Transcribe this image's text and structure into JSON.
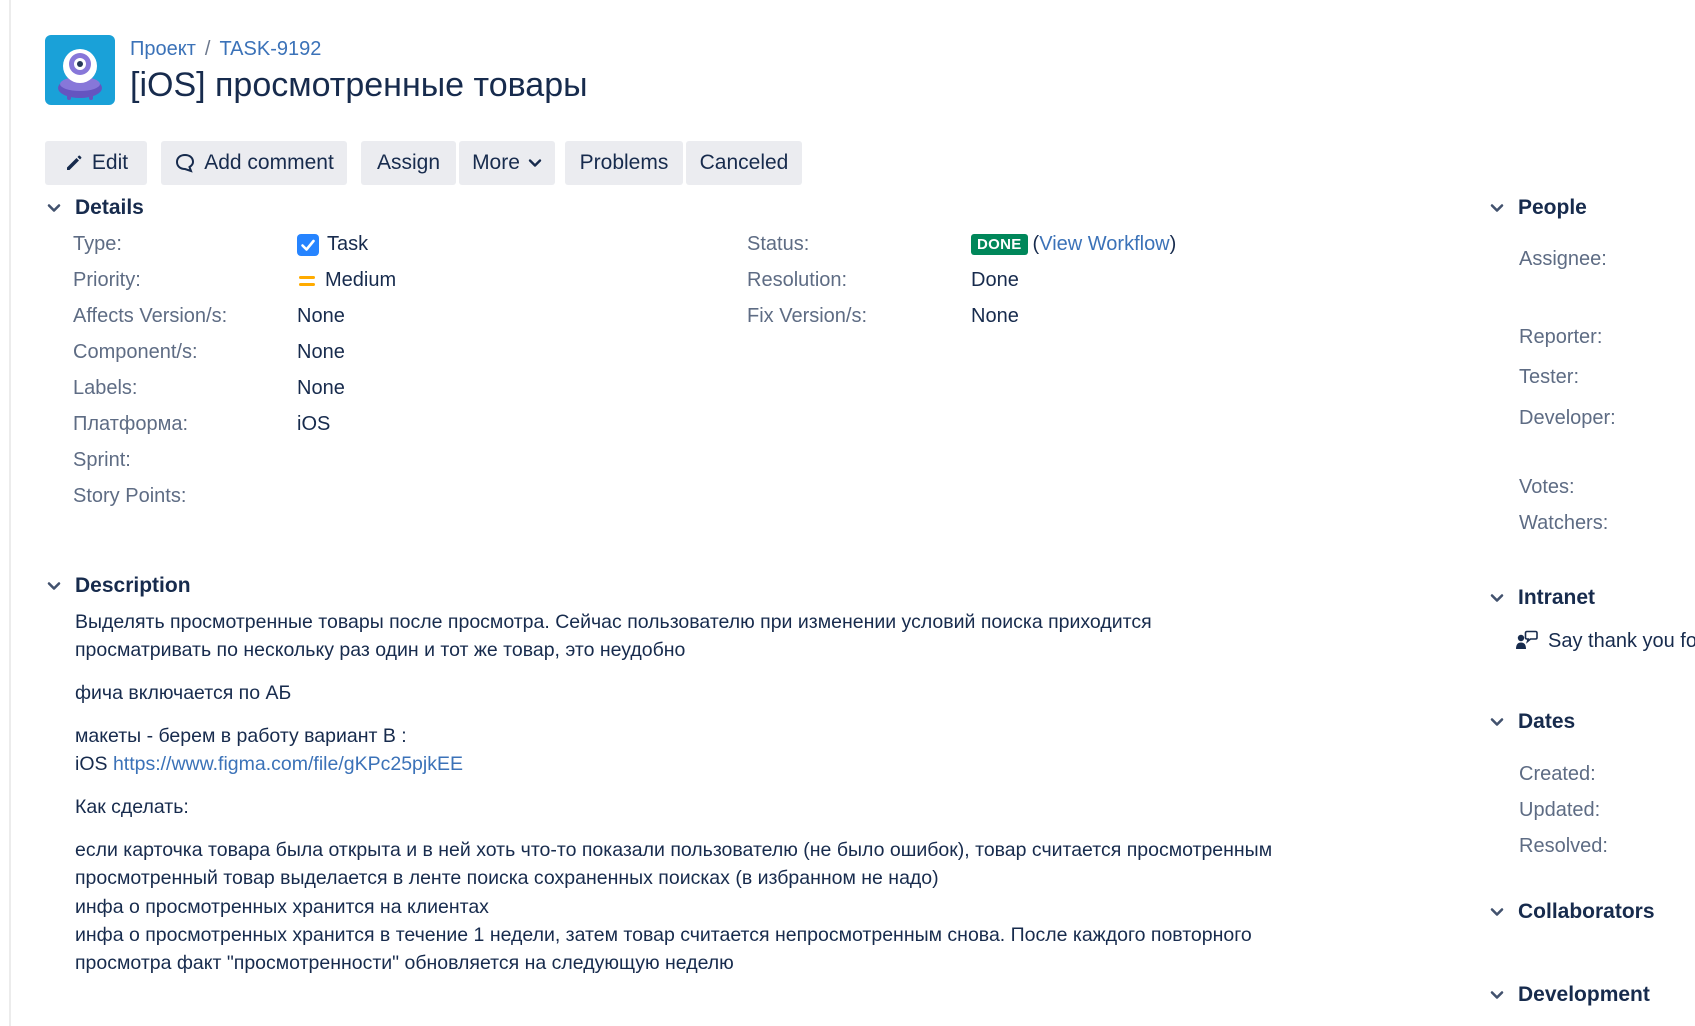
{
  "breadcrumb": {
    "project": "Проект",
    "separator": "/",
    "issue_key": "TASK-9192"
  },
  "title": "[iOS] просмотренные товары",
  "toolbar": {
    "edit": "Edit",
    "add_comment": "Add comment",
    "assign": "Assign",
    "more": "More",
    "problems": "Problems",
    "canceled": "Canceled"
  },
  "details": {
    "heading": "Details",
    "type_label": "Type:",
    "type_value": "Task",
    "priority_label": "Priority:",
    "priority_value": "Medium",
    "affects_label": "Affects Version/s:",
    "affects_value": "None",
    "component_label": "Component/s:",
    "component_value": "None",
    "labels_label": "Labels:",
    "labels_value": "None",
    "platform_label": "Платформа:",
    "platform_value": "iOS",
    "sprint_label": "Sprint:",
    "story_points_label": "Story Points:",
    "status_label": "Status:",
    "status_value": "DONE",
    "workflow_open": "(",
    "workflow_link": "View Workflow",
    "workflow_close": ")",
    "resolution_label": "Resolution:",
    "resolution_value": "Done",
    "fix_label": "Fix Version/s:",
    "fix_value": "None"
  },
  "description": {
    "heading": "Description",
    "line1": "Выделять просмотренные товары после просмотра. Сейчас пользователю при изменении условий поиска приходится",
    "line2": "просматривать по нескольку раз один и тот же товар, это неудобно",
    "line3": "фича включается по АБ",
    "line4": "макеты - берем в работу вариант В :",
    "line5_prefix": "iOS",
    "line5_link": "https://www.figma.com/file/gKPc25pjkEE",
    "line6": "Как сделать:",
    "line7": "если карточка товара была открыта и в ней хоть что-то показали пользователю (не было ошибок), товар считается просмотренным",
    "line8": "просмотренный товар выделается в ленте поиска сохраненных поисках (в избранном не надо)",
    "line9": "инфа о просмотренных хранится на клиентах",
    "line10": "инфа о просмотренных хранится в течение 1 недели, затем товар считается непросмотренным снова. После каждого повторного",
    "line11": "просмотра факт \"просмотренности\" обновляется на следующую неделю"
  },
  "people": {
    "heading": "People",
    "assignee": "Assignee:",
    "reporter": "Reporter:",
    "tester": "Tester:",
    "developer": "Developer:",
    "votes": "Votes:",
    "watchers": "Watchers:"
  },
  "intranet": {
    "heading": "Intranet",
    "thanks": "Say thank you for"
  },
  "dates": {
    "heading": "Dates",
    "created": "Created:",
    "updated": "Updated:",
    "resolved": "Resolved:"
  },
  "collaborators": {
    "heading": "Collaborators"
  },
  "development": {
    "heading": "Development"
  },
  "colors": {
    "link": "#3b72b8",
    "done": "#00875a",
    "priority_medium": "#ffab00",
    "button_bg": "#ebecf0",
    "task_blue": "#2684ff"
  }
}
